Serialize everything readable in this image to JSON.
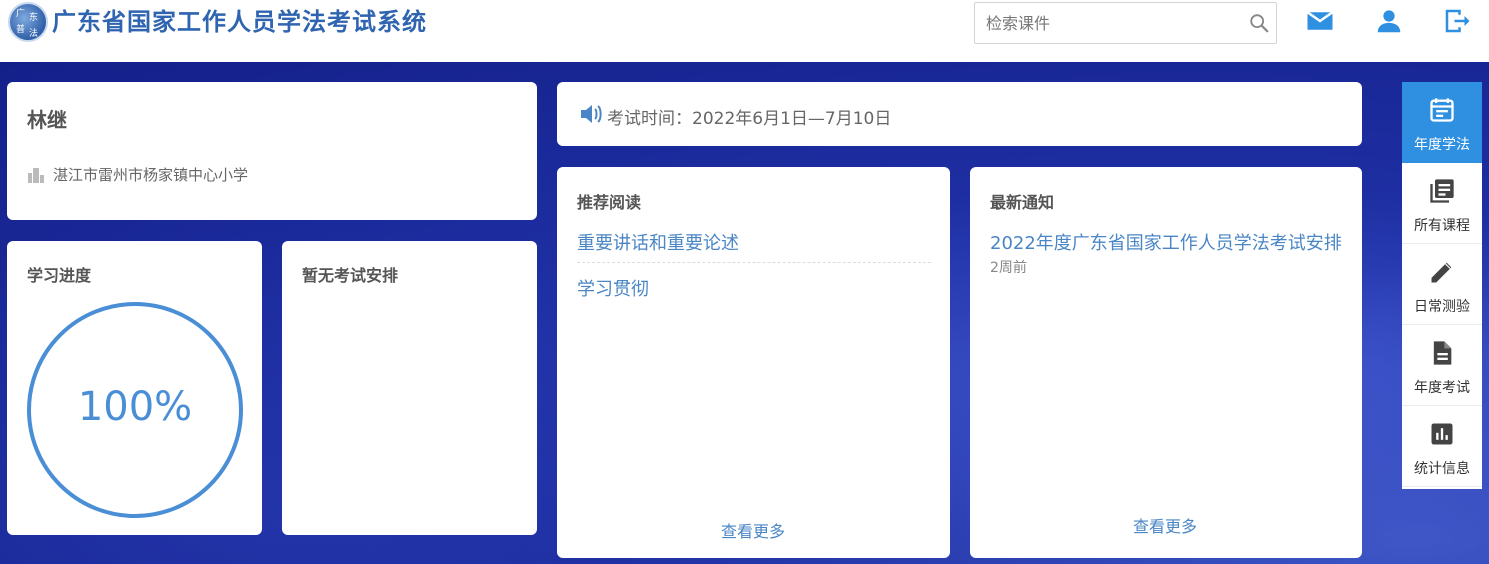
{
  "header": {
    "site_title": "广东省国家工作人员学法考试系统",
    "logo_chars": [
      "广",
      "东",
      "普",
      "法"
    ],
    "search_placeholder": "检索课件"
  },
  "user": {
    "name": "林继",
    "organization": "湛江市雷州市杨家镇中心小学"
  },
  "progress": {
    "title": "学习进度",
    "value_text": "100%",
    "value": 1.0
  },
  "exam": {
    "title": "暂无考试安排"
  },
  "notice_bar": {
    "text": "考试时间：2022年6月1日—7月10日"
  },
  "reading": {
    "title": "推荐阅读",
    "items": [
      "重要讲话和重要论述",
      "学习贯彻"
    ],
    "more": "查看更多"
  },
  "news": {
    "title": "最新通知",
    "items": [
      {
        "title": "2022年度广东省国家工作人员学法考试安排",
        "time": "2周前"
      }
    ],
    "more": "查看更多"
  },
  "side_nav": [
    {
      "label": "年度学法",
      "icon": "calendar-icon",
      "active": true
    },
    {
      "label": "所有课程",
      "icon": "library-icon",
      "active": false
    },
    {
      "label": "日常测验",
      "icon": "pencil-icon",
      "active": false
    },
    {
      "label": "年度考试",
      "icon": "document-icon",
      "active": false
    },
    {
      "label": "统计信息",
      "icon": "bar-chart-icon",
      "active": false
    }
  ],
  "colors": {
    "brand": "#2f64b0",
    "accent": "#2f8fe0",
    "link": "#4a86c5",
    "progress": "#4a8ed6"
  }
}
